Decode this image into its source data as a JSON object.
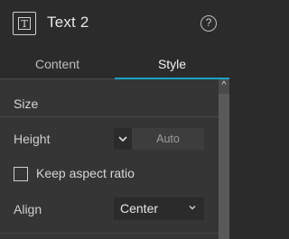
{
  "header": {
    "title": "Text 2",
    "icon_glyph": "T",
    "help_glyph": "?"
  },
  "tabs": [
    {
      "label": "Content",
      "active": false
    },
    {
      "label": "Style",
      "active": true
    }
  ],
  "colors": {
    "accent": "#1aa3c8"
  },
  "size_section": {
    "label": "Size",
    "height": {
      "label": "Height",
      "value": "Auto"
    },
    "keep_aspect_ratio": {
      "label": "Keep aspect ratio",
      "checked": false
    }
  },
  "align": {
    "label": "Align",
    "value": "Center"
  },
  "scroll_up_glyph": "^"
}
